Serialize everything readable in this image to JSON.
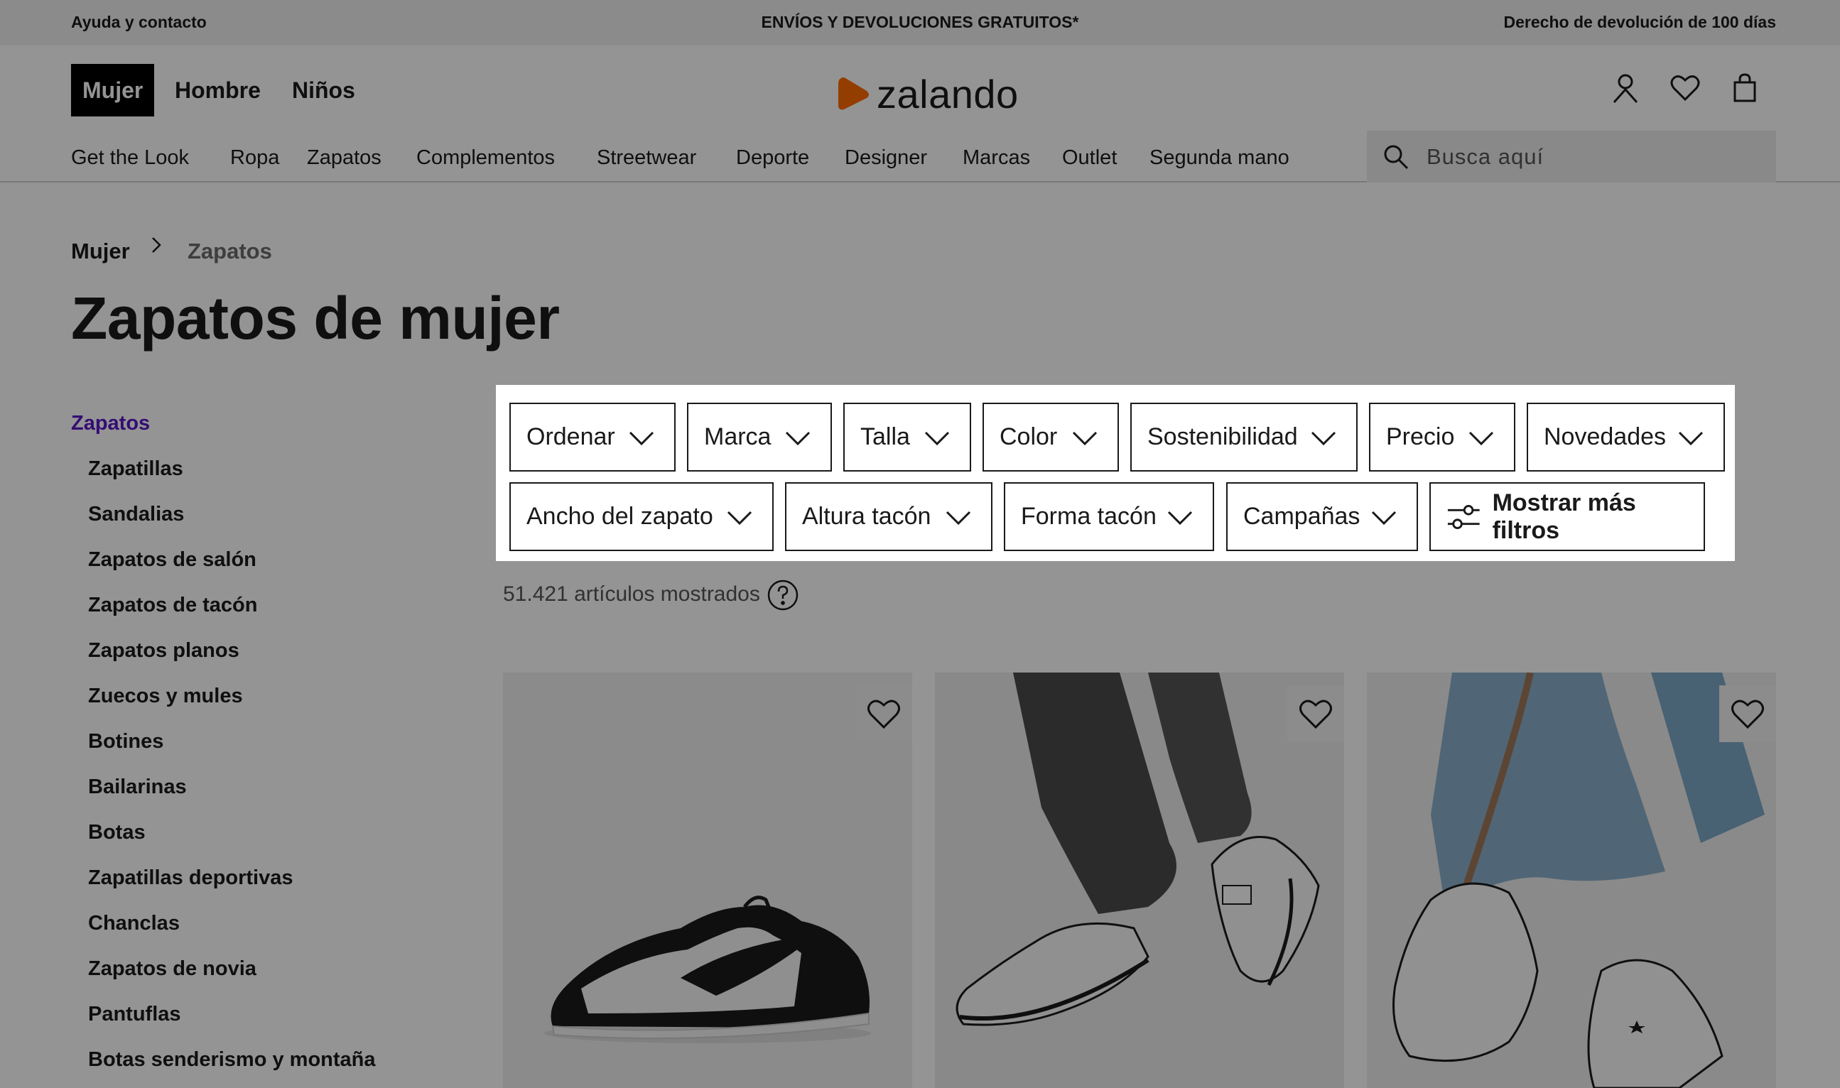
{
  "topbar": {
    "help": "Ayuda y contacto",
    "shipping": "ENVÍOS Y DEVOLUCIONES GRATUITOS*",
    "returns": "Derecho de devolución de 100 días"
  },
  "header": {
    "genders": [
      "Mujer",
      "Hombre",
      "Niños"
    ],
    "logo": "zalando",
    "categories": [
      "Get the Look",
      "Ropa",
      "Zapatos",
      "Complementos",
      "Streetwear",
      "Deporte",
      "Designer",
      "Marcas",
      "Outlet",
      "Segunda mano"
    ],
    "search_placeholder": "Busca aquí"
  },
  "breadcrumb": {
    "home": "Mujer",
    "current": "Zapatos"
  },
  "page_title": "Zapatos de mujer",
  "sidebar": {
    "heading": "Zapatos",
    "items": [
      "Zapatillas",
      "Sandalias",
      "Zapatos de salón",
      "Zapatos de tacón",
      "Zapatos planos",
      "Zuecos y mules",
      "Botines",
      "Bailarinas",
      "Botas",
      "Zapatillas deportivas",
      "Chanclas",
      "Zapatos de novia",
      "Pantuflas",
      "Botas senderismo y montaña"
    ]
  },
  "filters": {
    "row1": [
      "Ordenar",
      "Marca",
      "Talla",
      "Color",
      "Sostenibilidad",
      "Precio",
      "Novedades"
    ],
    "row2": [
      "Ancho del zapato",
      "Altura tacón",
      "Forma tacón",
      "Campañas"
    ],
    "more": "Mostrar más filtros"
  },
  "results": {
    "count_text": "51.421 artículos mostrados"
  },
  "colors": {
    "accent_purple": "#5a17c8",
    "logo_orange": "#ff6900",
    "dim_overlay": "rgba(0,0,0,0.42)"
  }
}
